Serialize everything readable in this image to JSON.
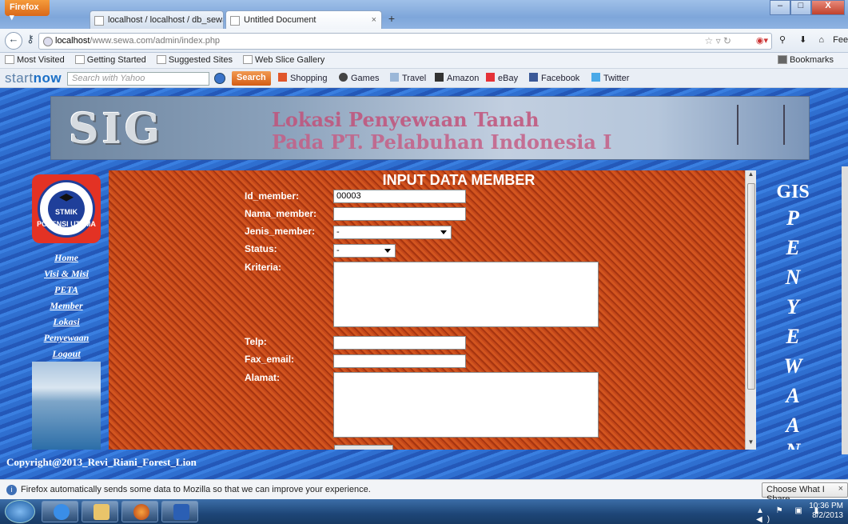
{
  "browser": {
    "firefox_button": "Firefox",
    "tabs": [
      {
        "label": "localhost / localhost / db_sewatanah ..."
      },
      {
        "label": "Untitled Document"
      }
    ],
    "new_tab": "+",
    "url_host": "localhost",
    "url_path": "/www.sewa.com/admin/index.php",
    "feedback": "Feedback",
    "bookmarks_bar": [
      "Most Visited",
      "Getting Started",
      "Suggested Sites",
      "Web Slice Gallery"
    ],
    "bookmarks_right": "Bookmarks",
    "toolbar": {
      "brand_a": "start",
      "brand_b": "now",
      "search_placeholder": "Search with Yahoo",
      "search_button": "Search",
      "links": [
        "Shopping",
        "Games",
        "Travel",
        "Amazon",
        "eBay",
        "Facebook",
        "Twitter"
      ]
    }
  },
  "page": {
    "banner_logo": "SIG",
    "banner_line1": "Lokasi Penyewaan Tanah",
    "banner_line2": "Pada PT. Pelabuhan Indonesia I",
    "logo_text_top": "STMIK",
    "logo_text_bottom": "POTENSI UTAMA",
    "menu": [
      "Home",
      "Visi & Misi",
      "PETA",
      "Member",
      "Lokasi",
      "Penyewaan",
      "Logout"
    ],
    "form": {
      "title": "INPUT DATA MEMBER",
      "labels": {
        "id_member": "Id_member:",
        "nama_member": "Nama_member:",
        "jenis_member": "Jenis_member:",
        "status": "Status:",
        "kriteria": "Kriteria:",
        "telp": "Telp:",
        "fax_email": "Fax_email:",
        "alamat": "Alamat:"
      },
      "values": {
        "id_member": "00003",
        "nama_member": "",
        "jenis_member": "-",
        "status": "-",
        "telp": "",
        "fax_email": ""
      }
    },
    "right_title": "GIS",
    "right_letters": [
      "P",
      "E",
      "N",
      "Y",
      "E",
      "W",
      "A",
      "A",
      "N"
    ],
    "copyright": "Copyright@2013_Revi_Riani_Forest_Lion"
  },
  "notification": {
    "message": "Firefox automatically sends some data to Mozilla so that we can improve your experience.",
    "button": "Choose What I Share",
    "close": "×"
  },
  "taskbar": {
    "time": "10:36 PM",
    "date": "8/2/2013"
  }
}
